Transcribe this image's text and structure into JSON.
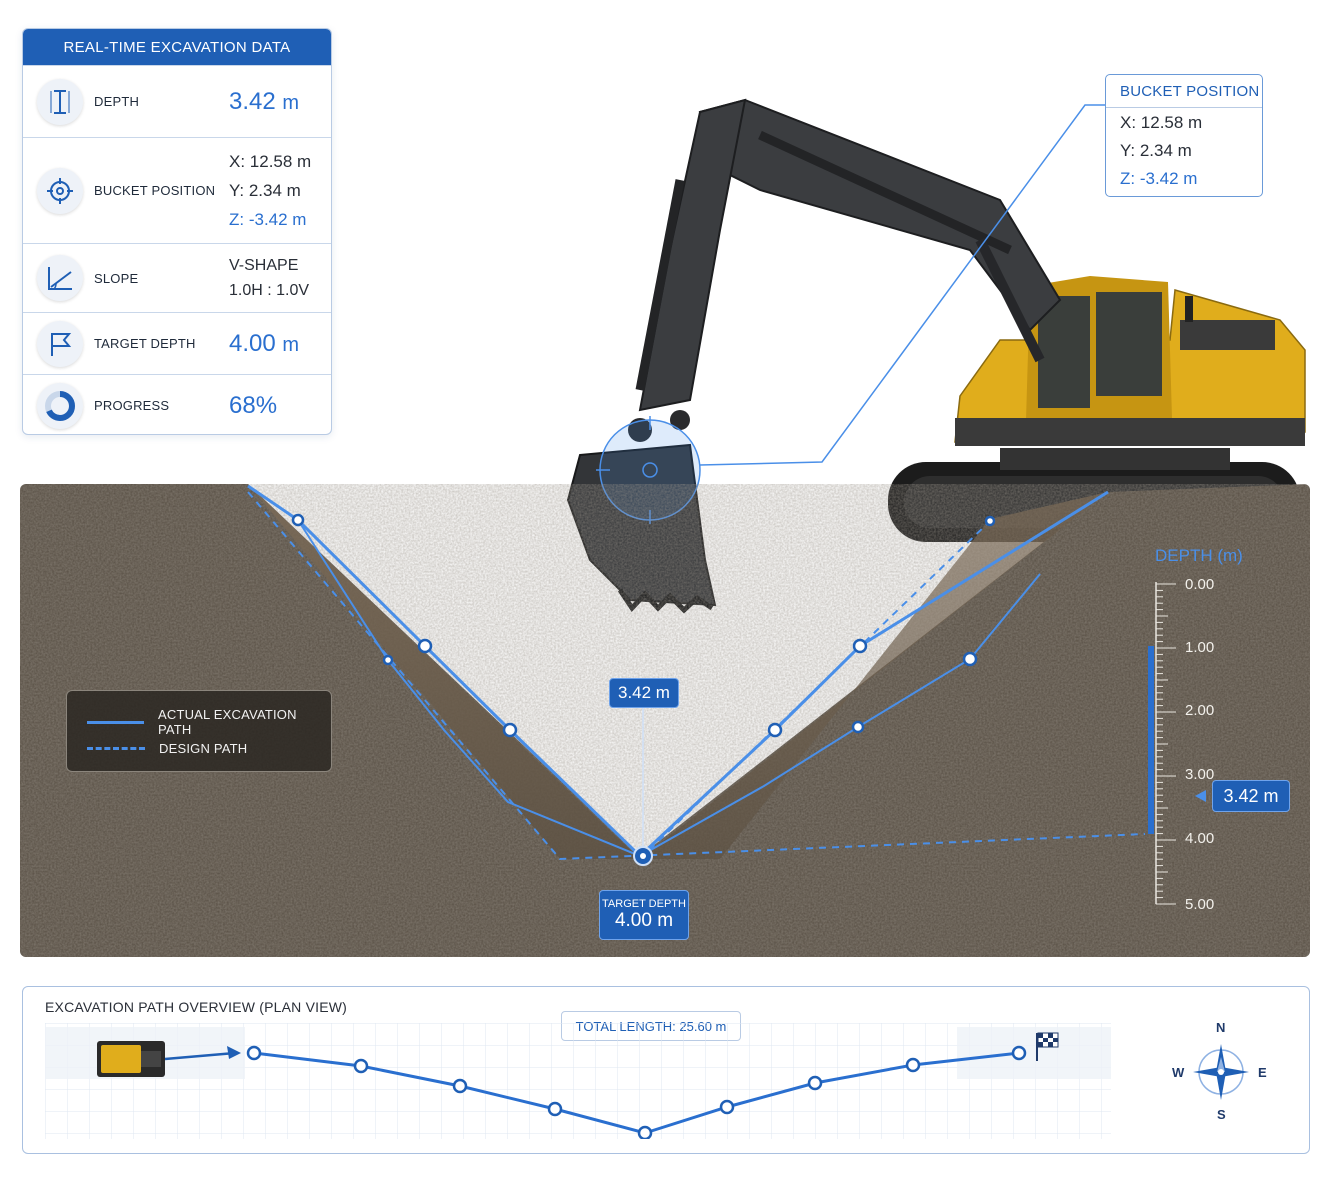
{
  "panel": {
    "title": "REAL-TIME EXCAVATION DATA",
    "depth": {
      "label": "DEPTH",
      "value": "3.42",
      "unit": "m"
    },
    "bucket": {
      "label": "BUCKET POSITION",
      "x": "X:  12.58 m",
      "y": "Y:   2.34 m",
      "z": "Z:  -3.42 m"
    },
    "slope": {
      "label": "SLOPE",
      "shape": "V-SHAPE",
      "ratio": "1.0H : 1.0V"
    },
    "target": {
      "label": "TARGET DEPTH",
      "value": "4.00",
      "unit": "m"
    },
    "progress": {
      "label": "PROGRESS",
      "value": "68%",
      "fraction": 0.68
    }
  },
  "callout": {
    "title": "BUCKET POSITION",
    "x": "X:   12.58 m",
    "y": "Y:    2.34 m",
    "z": "Z:   -3.42 m"
  },
  "section": {
    "legend": {
      "actual": "ACTUAL EXCAVATION PATH",
      "design": "DESIGN PATH"
    },
    "current_depth_tag": "3.42 m",
    "target_tag": {
      "label": "TARGET DEPTH",
      "value": "4.00 m"
    },
    "depth_axis": {
      "title": "DEPTH (m)",
      "ticks": [
        "0.00",
        "1.00",
        "2.00",
        "3.00",
        "4.00",
        "5.00"
      ],
      "current": "3.42 m",
      "current_value": 3.42
    }
  },
  "plan": {
    "title": "EXCAVATION PATH OVERVIEW (PLAN VIEW)",
    "total_length": "TOTAL LENGTH: 25.60 m",
    "compass": {
      "n": "N",
      "s": "S",
      "e": "E",
      "w": "W"
    },
    "icons": {
      "start": "excavator-top-icon",
      "finish": "checkered-flag-icon"
    }
  },
  "colors": {
    "accent": "#1f5fb5",
    "path": "#2a6fcf",
    "soil": "#5a5246",
    "machine": "#e0ad1c"
  }
}
